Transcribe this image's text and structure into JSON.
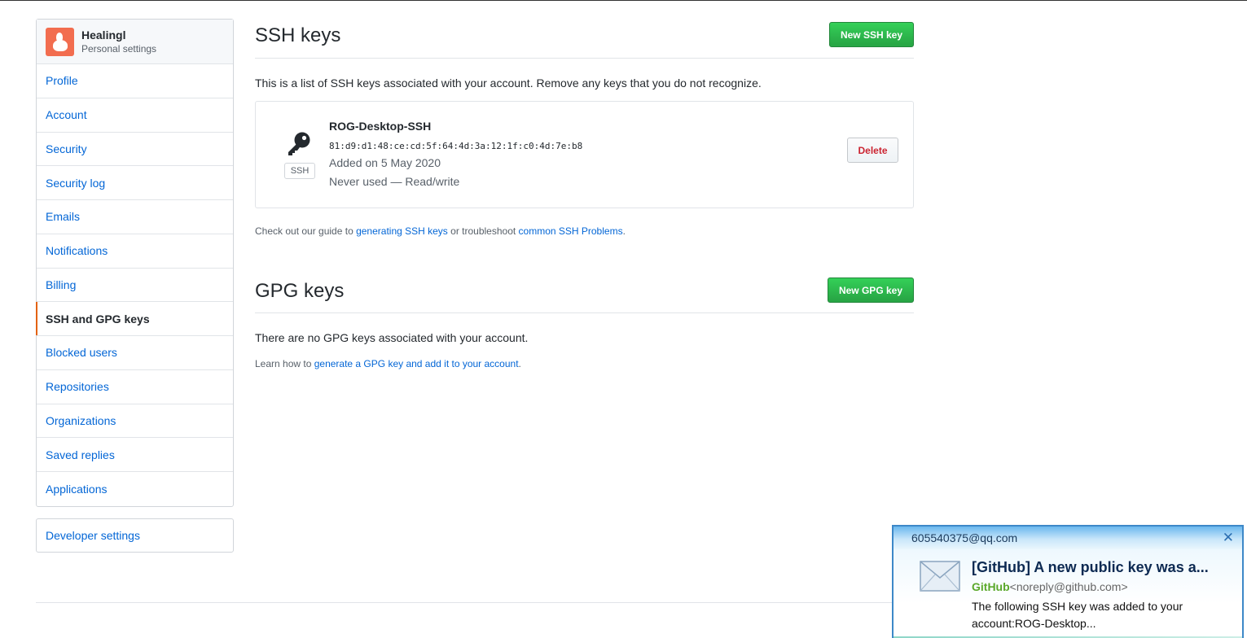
{
  "sidebar": {
    "user_name": "Healingl",
    "user_subtitle": "Personal settings",
    "items": [
      {
        "label": "Profile"
      },
      {
        "label": "Account"
      },
      {
        "label": "Security"
      },
      {
        "label": "Security log"
      },
      {
        "label": "Emails"
      },
      {
        "label": "Notifications"
      },
      {
        "label": "Billing"
      },
      {
        "label": "SSH and GPG keys",
        "selected": true
      },
      {
        "label": "Blocked users"
      },
      {
        "label": "Repositories"
      },
      {
        "label": "Organizations"
      },
      {
        "label": "Saved replies"
      },
      {
        "label": "Applications"
      }
    ],
    "developer_settings": "Developer settings"
  },
  "ssh": {
    "title": "SSH keys",
    "new_button": "New SSH key",
    "description": "This is a list of SSH keys associated with your account. Remove any keys that you do not recognize.",
    "key": {
      "type_label": "SSH",
      "name": "ROG-Desktop-SSH",
      "fingerprint": "81:d9:d1:48:ce:cd:5f:64:4d:3a:12:1f:c0:4d:7e:b8",
      "added": "Added on 5 May 2020",
      "usage": "Never used — Read/write",
      "delete_label": "Delete"
    },
    "guide_prefix": "Check out our guide to ",
    "guide_link1": "generating SSH keys",
    "guide_middle": " or troubleshoot ",
    "guide_link2": "common SSH Problems",
    "guide_suffix": "."
  },
  "gpg": {
    "title": "GPG keys",
    "new_button": "New GPG key",
    "empty_text": "There are no GPG keys associated with your account.",
    "learn_prefix": "Learn how to ",
    "learn_link": "generate a GPG key and add it to your account",
    "learn_suffix": "."
  },
  "notification": {
    "account": "605540375@qq.com",
    "close_icon": "close-icon",
    "subject": "[GitHub] A new public key was a...",
    "from_name": "GitHub",
    "from_address": "<noreply@github.com>",
    "preview": "The following SSH key was added to your account:ROG-Desktop..."
  },
  "colors": {
    "link": "#0366d6",
    "selected_marker": "#e36209",
    "green_button": "#28a745",
    "delete_text": "#cb2431"
  }
}
